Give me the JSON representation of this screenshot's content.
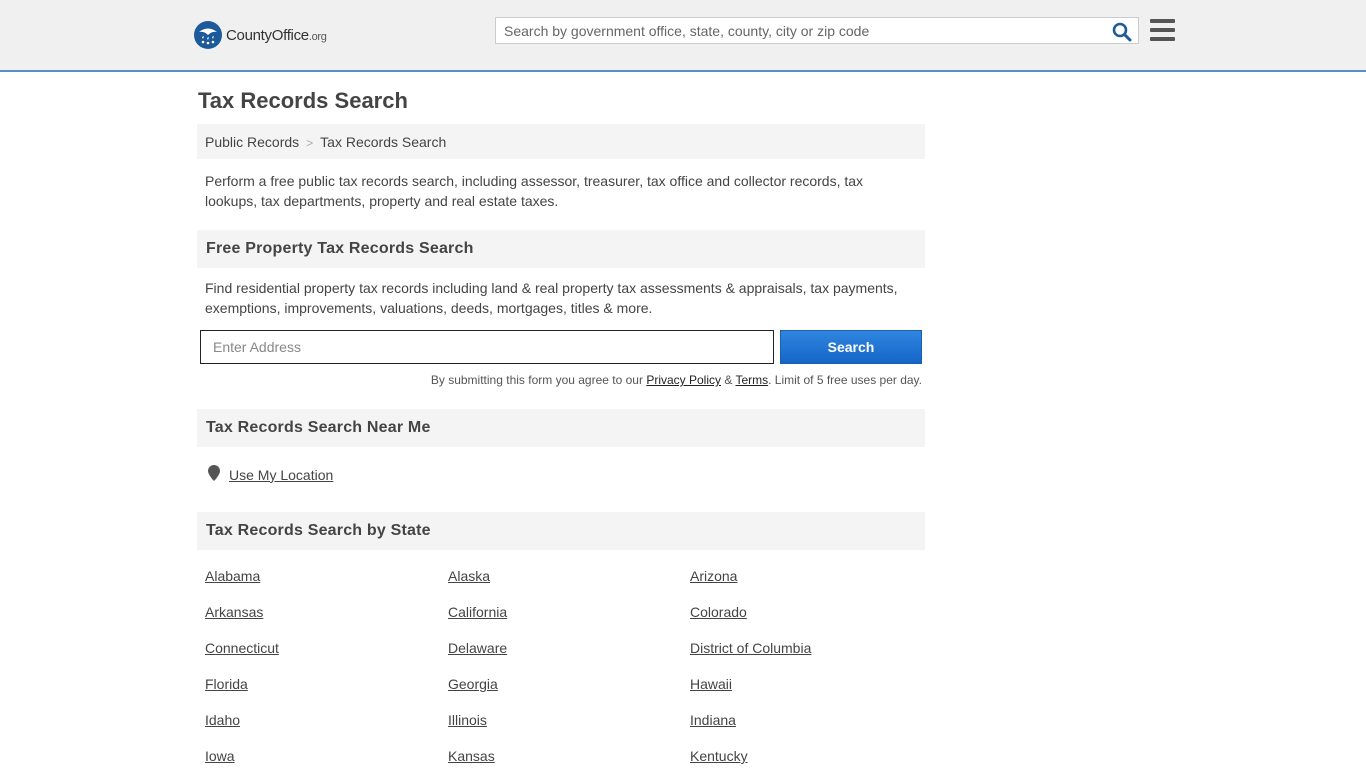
{
  "header": {
    "logo_text": "CountyOffice",
    "logo_tld": ".org",
    "search_placeholder": "Search by government office, state, county, city or zip code"
  },
  "page": {
    "title": "Tax Records Search",
    "breadcrumb": [
      "Public Records",
      "Tax Records Search"
    ],
    "breadcrumb_separator": ">",
    "intro": "Perform a free public tax records search, including assessor, treasurer, tax office and collector records, tax lookups, tax departments, property and real estate taxes."
  },
  "property_search": {
    "heading": "Free Property Tax Records Search",
    "description": "Find residential property tax records including land & real property tax assessments & appraisals, tax payments, exemptions, improvements, valuations, deeds, mortgages, titles & more.",
    "input_placeholder": "Enter Address",
    "button_label": "Search",
    "disclaimer_prefix": "By submitting this form you agree to our ",
    "privacy_label": "Privacy Policy",
    "amp": " & ",
    "terms_label": "Terms",
    "disclaimer_suffix": ". Limit of 5 free uses per day."
  },
  "near_me": {
    "heading": "Tax Records Search Near Me",
    "link_label": "Use My Location"
  },
  "by_state": {
    "heading": "Tax Records Search by State",
    "states": [
      "Alabama",
      "Alaska",
      "Arizona",
      "Arkansas",
      "California",
      "Colorado",
      "Connecticut",
      "Delaware",
      "District of Columbia",
      "Florida",
      "Georgia",
      "Hawaii",
      "Idaho",
      "Illinois",
      "Indiana",
      "Iowa",
      "Kansas",
      "Kentucky"
    ]
  },
  "colors": {
    "accent": "#1565c8",
    "header_bg": "#f0f0f0",
    "header_border": "#5a8fc6",
    "section_bg": "#f4f4f4",
    "logo_blue": "#1d5a9a"
  },
  "icons": {
    "logo": "eagle-stars-badge",
    "search": "magnifier-icon",
    "menu": "hamburger-icon",
    "location": "map-pin-icon"
  }
}
